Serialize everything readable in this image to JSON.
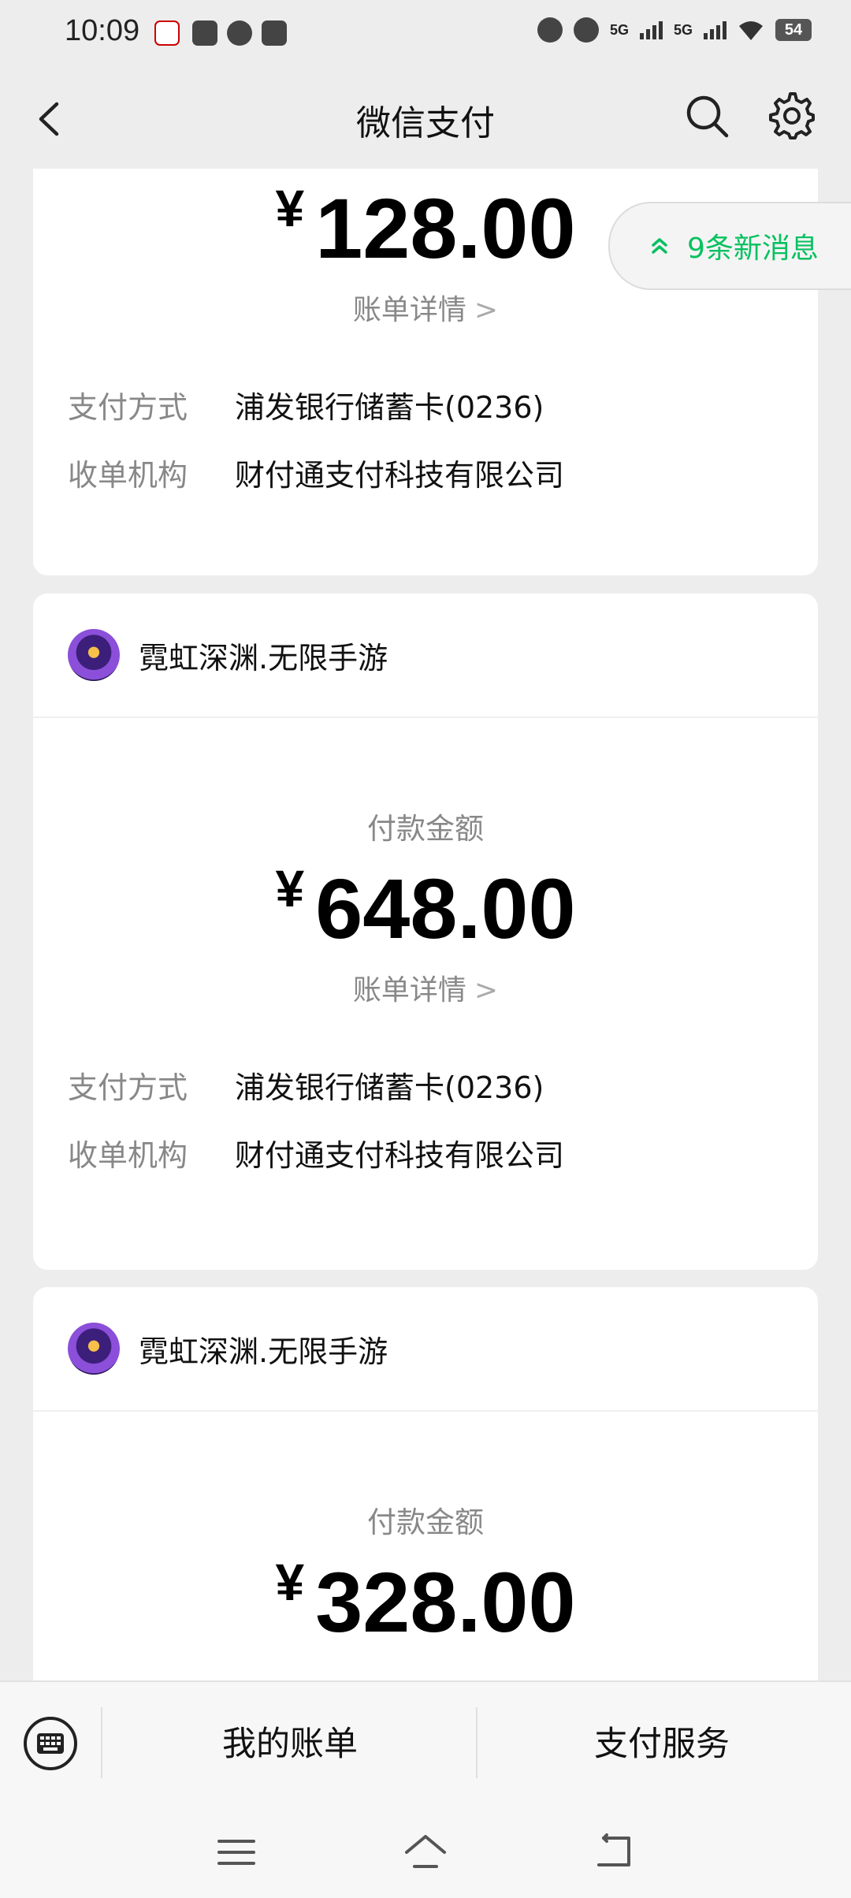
{
  "status_bar": {
    "time": "10:09",
    "signal_1": "5G",
    "signal_2": "5G",
    "battery": "54"
  },
  "nav": {
    "title": "微信支付"
  },
  "new_messages": {
    "label": "9条新消息"
  },
  "payments": [
    {
      "merchant": "",
      "pay_label": "",
      "currency": "¥",
      "amount": "128.00",
      "detail_link": "账单详情",
      "method_key": "支付方式",
      "method_value": "浦发银行储蓄卡(0236)",
      "acquirer_key": "收单机构",
      "acquirer_value": "财付通支付科技有限公司"
    },
    {
      "merchant": "霓虹深渊.无限手游",
      "pay_label": "付款金额",
      "currency": "¥",
      "amount": "648.00",
      "detail_link": "账单详情",
      "method_key": "支付方式",
      "method_value": "浦发银行储蓄卡(0236)",
      "acquirer_key": "收单机构",
      "acquirer_value": "财付通支付科技有限公司"
    },
    {
      "merchant": "霓虹深渊.无限手游",
      "pay_label": "付款金额",
      "currency": "¥",
      "amount": "328.00"
    }
  ],
  "bottom_menu": {
    "my_bills": "我的账单",
    "pay_services": "支付服务"
  },
  "colors": {
    "accent_green": "#07c160",
    "background": "#ededed"
  }
}
